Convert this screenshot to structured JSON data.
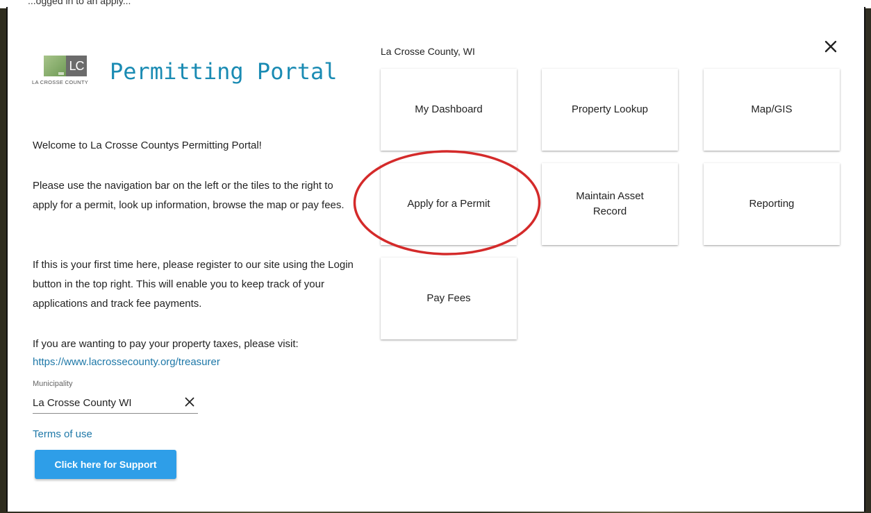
{
  "window": {
    "top_caption": "...ogged in to an apply..."
  },
  "header": {
    "logo_initials": "LC",
    "logo_subtitle": "LA CROSSE COUNTY",
    "title": "Permitting Portal",
    "county": "La Crosse County, WI"
  },
  "intro": {
    "welcome": "Welcome to La Crosse Countys Permitting Portal!",
    "paragraph1": "Please use the navigation bar on the left or the tiles to the right to apply for a permit, look up information, browse the map or pay fees.",
    "paragraph2": "If this is your first time here, please register to our site using the Login button in the top right. This will enable you to keep track of your applications and track fee payments.",
    "paragraph3": "If you are wanting to pay your property taxes, please visit:",
    "tax_link": "https://www.lacrossecounty.org/treasurer"
  },
  "municipality": {
    "label": "Municipality",
    "value": "La Crosse County WI"
  },
  "footer": {
    "terms_label": "Terms of use",
    "support_label": "Click here for Support"
  },
  "tiles": [
    {
      "label": "My Dashboard"
    },
    {
      "label": "Property Lookup"
    },
    {
      "label": "Map/GIS"
    },
    {
      "label": "Apply for a Permit"
    },
    {
      "label": "Maintain Asset Record"
    },
    {
      "label": "Reporting"
    },
    {
      "label": "Pay Fees"
    }
  ],
  "icons": {
    "close": "close-icon",
    "clear": "clear-icon"
  },
  "colors": {
    "accent": "#1a8bb3",
    "link": "#1e78a8",
    "button": "#2e9ee8",
    "annotation": "#d42a2a"
  }
}
